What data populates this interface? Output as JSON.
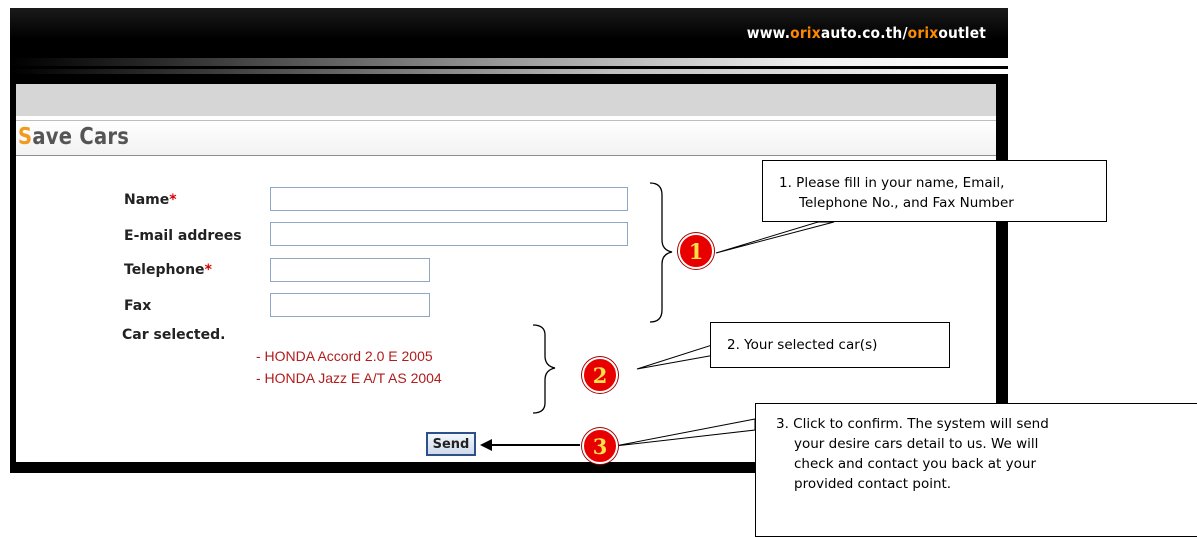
{
  "header": {
    "url_prefix": "www.",
    "url_brand1": "orix",
    "url_mid": "auto.co.th/",
    "url_brand2": "orix",
    "url_suffix": "outlet"
  },
  "page": {
    "title_first": "S",
    "title_rest": "ave Cars"
  },
  "form": {
    "name_label": "Name",
    "email_label": "E-mail addrees",
    "telephone_label": "Telephone",
    "fax_label": "Fax",
    "required_mark": "*",
    "car_selected_label": "Car selected.",
    "name_value": "",
    "email_value": "",
    "telephone_value": "",
    "fax_value": "",
    "cars": [
      "- HONDA Accord 2.0 E 2005",
      "- HONDA Jazz E A/T AS 2004"
    ],
    "send_label": "Send"
  },
  "callouts": {
    "c1_line1": "1. Please fill in your name, Email,",
    "c1_line2": "Telephone No., and Fax Number",
    "c2": "2. Your selected car(s)",
    "c3_line1": "3. Click to confirm. The system will send",
    "c3_line2": "your desire cars detail to us. We will",
    "c3_line3": "check and contact you back at your",
    "c3_line4": "provided contact point.",
    "badge1": "1",
    "badge2": "2",
    "badge3": "3"
  },
  "colors": {
    "brand_orange": "#ff8a00",
    "title_orange": "#f29a1d",
    "required_red": "#d40000",
    "car_text": "#b01d1d",
    "badge_red": "#e80000",
    "badge_text": "#ffe24a"
  }
}
